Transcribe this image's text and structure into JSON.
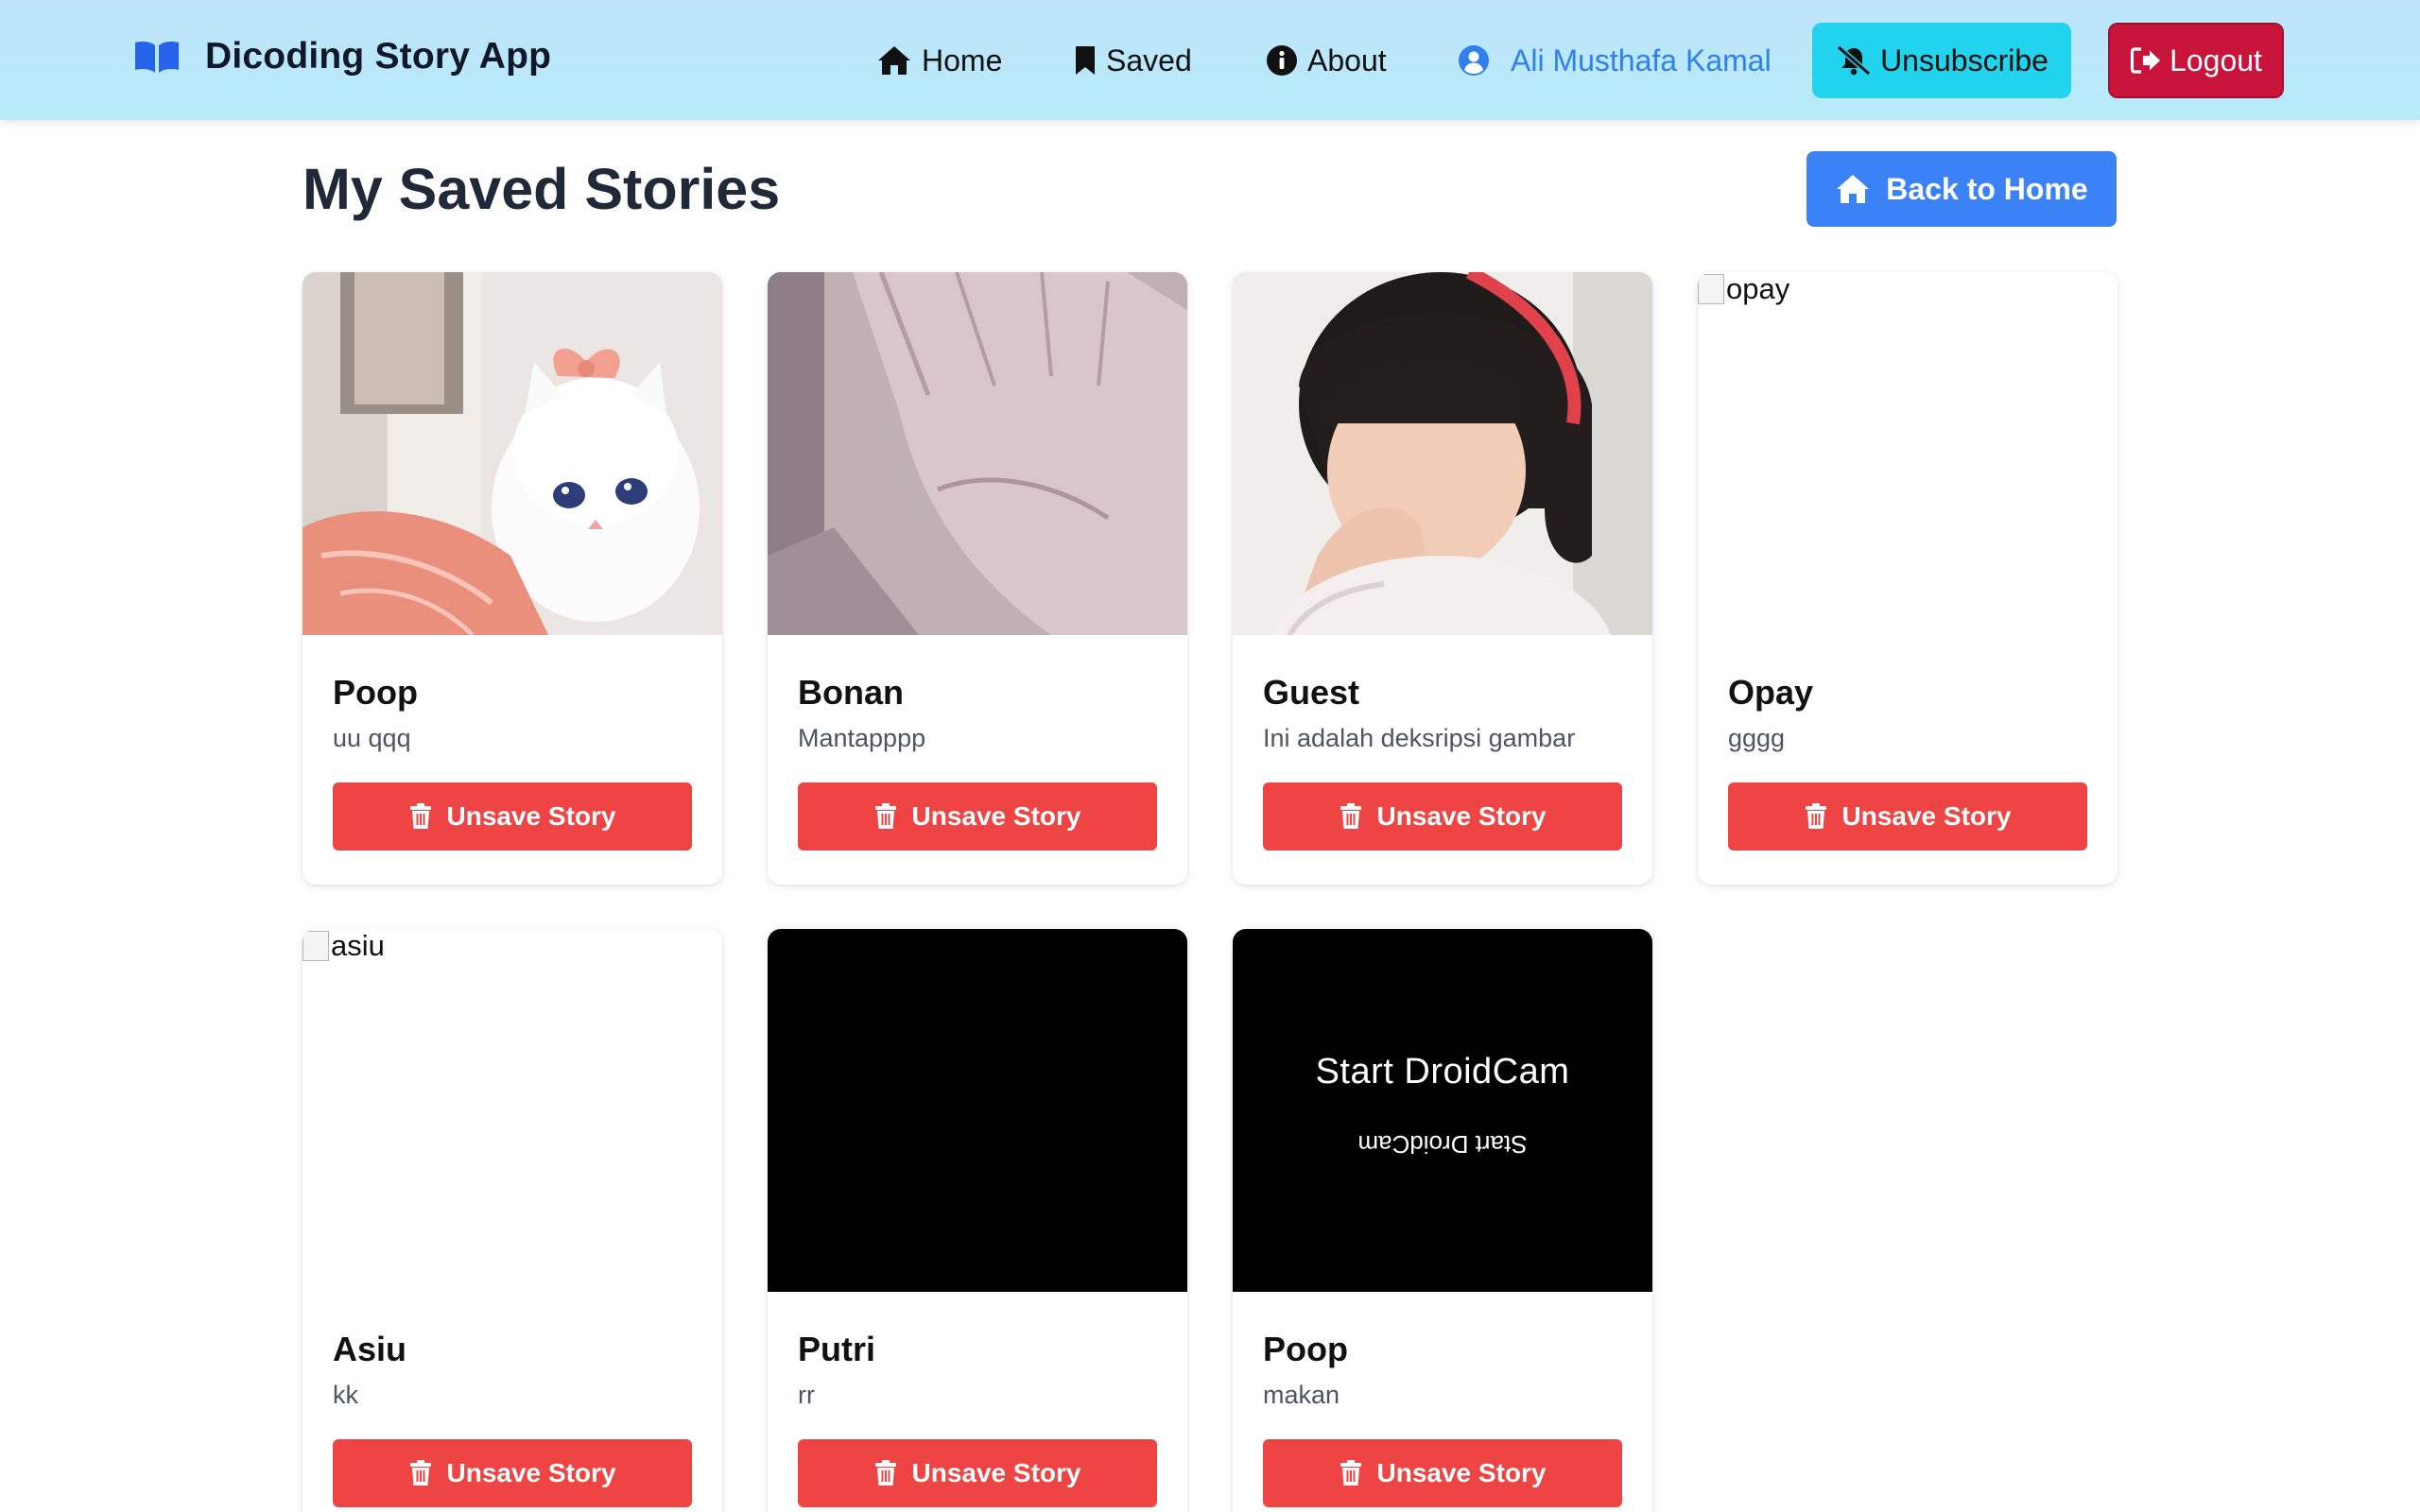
{
  "app": {
    "title": "Dicoding Story App",
    "brand_icon": "book-open-icon"
  },
  "nav": {
    "home": "Home",
    "saved": "Saved",
    "about": "About",
    "user_name": "Ali Musthafa Kamal",
    "unsubscribe": "Unsubscribe",
    "logout": "Logout"
  },
  "page": {
    "title": "My Saved Stories",
    "back_button": "Back to Home"
  },
  "unsave_label": "Unsave Story",
  "stories": [
    {
      "name": "Poop",
      "description": "uu qqq",
      "image": "white-cat-photo"
    },
    {
      "name": "Bonan",
      "description": "Mantapppp",
      "image": "hand-photo"
    },
    {
      "name": "Guest",
      "description": "Ini adalah deksripsi gambar",
      "image": "crying-child-photo"
    },
    {
      "name": "Opay",
      "description": "gggg",
      "image": "broken-image",
      "alt": "opay"
    },
    {
      "name": "Asiu",
      "description": "kk",
      "image": "broken-image",
      "alt": "asiu"
    },
    {
      "name": "Putri",
      "description": "rr",
      "image": "black-photo"
    },
    {
      "name": "Poop",
      "description": "makan",
      "image": "droidcam-screen",
      "overlay_text": "Start DroidCam"
    }
  ],
  "colors": {
    "header_gradient": [
      "#bfe3fa",
      "#b7ecf9"
    ],
    "unsubscribe_bg": "#22d3ee",
    "logout_bg": "#c8143b",
    "back_button_bg": "#3b82f6",
    "unsave_bg": "#ef4444",
    "user_link": "#2f80ed",
    "brand_icon": "#2563eb"
  }
}
